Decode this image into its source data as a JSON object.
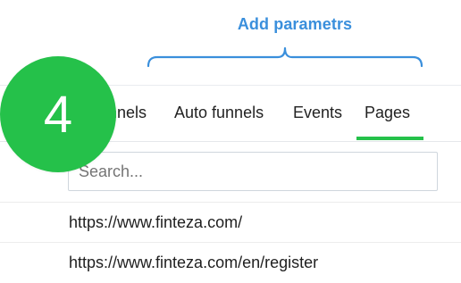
{
  "annotation": {
    "label": "Add parametrs",
    "color": "#3a8fdc"
  },
  "step_badge": {
    "number": "4",
    "color": "#25c14a"
  },
  "tabs": [
    {
      "label": "Funnels",
      "selected": false
    },
    {
      "label": "Auto funnels",
      "selected": false
    },
    {
      "label": "Events",
      "selected": false
    },
    {
      "label": "Pages",
      "selected": true
    }
  ],
  "accent_color": "#25c14a",
  "search": {
    "placeholder": "Search...",
    "value": ""
  },
  "pages": [
    {
      "url": "https://www.finteza.com/"
    },
    {
      "url": "https://www.finteza.com/en/register"
    }
  ]
}
